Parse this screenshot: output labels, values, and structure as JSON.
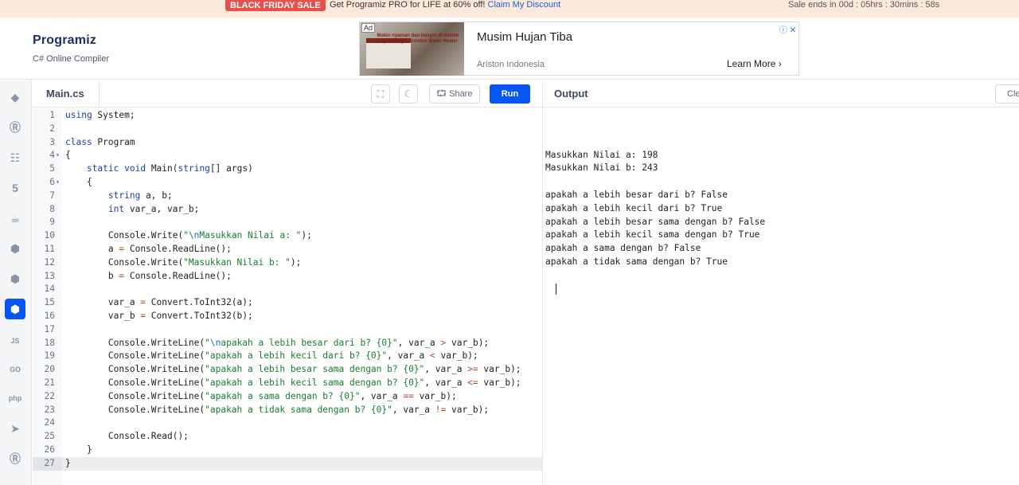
{
  "promo": {
    "badge": "BLACK FRIDAY SALE",
    "message": "Get Programiz PRO for LIFE at 60% off!",
    "link": "Claim My Discount",
    "timer": "Sale ends in 00d : 05hrs : 30mins : 58s"
  },
  "header": {
    "logo": "Programiz",
    "subtitle": "C# Online Compiler"
  },
  "ad": {
    "tag": "Ad",
    "image_text": "Makin nyaman dan hangat di musim hujan dengan Ariston Water Heater",
    "title": "Musim Hujan Tiba",
    "advertiser": "Ariston Indonesia",
    "cta": "Learn More"
  },
  "rail": {
    "items": [
      "python-icon",
      "r-icon",
      "sql-icon",
      "html-icon",
      "java-icon",
      "c-icon",
      "cpp-icon",
      "csharp-icon",
      "js-icon",
      "go-icon",
      "php-icon",
      "swift-icon",
      "rust-icon"
    ],
    "labels": {
      "js": "JS",
      "go": "GO",
      "php": "php"
    },
    "active_index": 7
  },
  "editor": {
    "file_tab": "Main.cs",
    "share_label": "Share",
    "run_label": "Run",
    "lines": [
      "using System;",
      "",
      "class Program",
      "{",
      "    static void Main(string[] args)",
      "    {",
      "        string a, b;",
      "        int var_a, var_b;",
      "",
      "        Console.Write(\"\\nMasukkan Nilai a: \");",
      "        a = Console.ReadLine();",
      "        Console.Write(\"Masukkan Nilai b: \");",
      "        b = Console.ReadLine();",
      "",
      "        var_a = Convert.ToInt32(a);",
      "        var_b = Convert.ToInt32(b);",
      "",
      "        Console.WriteLine(\"\\napakah a lebih besar dari b? {0}\", var_a > var_b);",
      "        Console.WriteLine(\"apakah a lebih kecil dari b? {0}\", var_a < var_b);",
      "        Console.WriteLine(\"apakah a lebih besar sama dengan b? {0}\", var_a >= var_b);",
      "        Console.WriteLine(\"apakah a lebih kecil sama dengan b? {0}\", var_a <= var_b);",
      "        Console.WriteLine(\"apakah a sama dengan b? {0}\", var_a == var_b);",
      "        Console.WriteLine(\"apakah a tidak sama dengan b? {0}\", var_a != var_b);",
      "",
      "        Console.Read();",
      "    }",
      "}"
    ],
    "current_line": 27,
    "fold_lines": [
      4,
      6
    ]
  },
  "output": {
    "label": "Output",
    "clear_label": "Cle",
    "lines": [
      "Masukkan Nilai a: 198",
      "Masukkan Nilai b: 243",
      "",
      "apakah a lebih besar dari b? False",
      "apakah a lebih kecil dari b? True",
      "apakah a lebih besar sama dengan b? False",
      "apakah a lebih kecil sama dengan b? True",
      "apakah a sama dengan b? False",
      "apakah a tidak sama dengan b? True"
    ]
  },
  "colors": {
    "accent": "#0556f3",
    "promo_bg": "#fde9db",
    "sale_badge": "#e8504b",
    "keyword": "#1f3da8",
    "string": "#1a7a34"
  }
}
